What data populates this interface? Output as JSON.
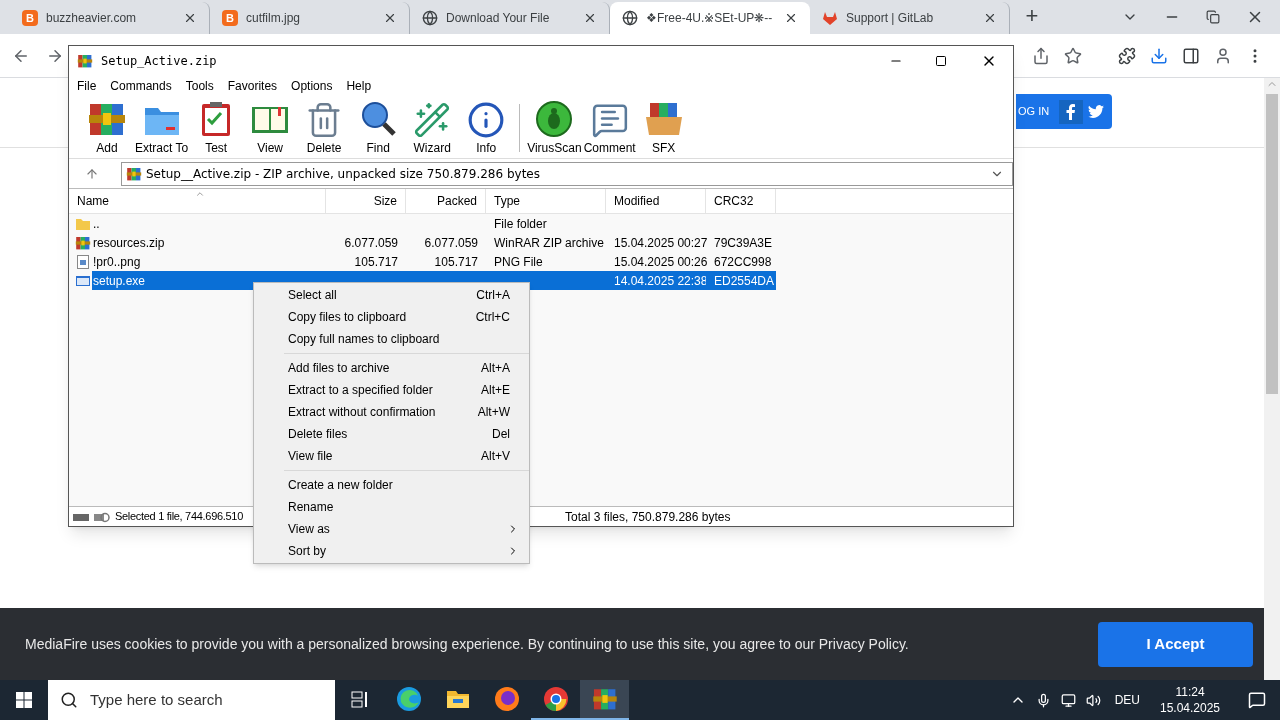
{
  "browser": {
    "tabs": [
      {
        "title": "buzzheavier.com",
        "kind": "letter",
        "favicon_text": "B",
        "selected": false
      },
      {
        "title": "cutfilm.jpg",
        "kind": "letter",
        "favicon_text": "B",
        "selected": false
      },
      {
        "title": "Download Your File",
        "kind": "globe",
        "selected": false
      },
      {
        "title": "❖Free-4U.※SEt-UP❋--",
        "kind": "globe",
        "selected": true
      },
      {
        "title": "Support | GitLab",
        "kind": "fox",
        "selected": false
      }
    ],
    "new_tab": "+"
  },
  "page": {
    "login_button": "OG IN",
    "cookie_banner": {
      "text": "MediaFire uses cookies to provide you with a personalized browsing experience. By continuing to use this site, you agree to our Privacy Policy.",
      "button": "I Accept"
    }
  },
  "winrar": {
    "title": "Setup_Active.zip",
    "menu": [
      "File",
      "Commands",
      "Tools",
      "Favorites",
      "Options",
      "Help"
    ],
    "toolbar_groups": [
      [
        {
          "label": "Add",
          "kind": "add"
        },
        {
          "label": "Extract To",
          "kind": "extract"
        },
        {
          "label": "Test",
          "kind": "test"
        },
        {
          "label": "View",
          "kind": "view"
        },
        {
          "label": "Delete",
          "kind": "delete"
        },
        {
          "label": "Find",
          "kind": "find"
        },
        {
          "label": "Wizard",
          "kind": "wizard"
        },
        {
          "label": "Info",
          "kind": "info"
        }
      ],
      [
        {
          "label": "VirusScan",
          "kind": "virus"
        },
        {
          "label": "Comment",
          "kind": "comment"
        },
        {
          "label": "SFX",
          "kind": "sfx"
        }
      ]
    ],
    "path": "Setup__Active.zip - ZIP archive, unpacked size 750.879.286 bytes",
    "columns": [
      "Name",
      "Size",
      "Packed",
      "Type",
      "Modified",
      "CRC32"
    ],
    "rows": [
      {
        "kind": "folder",
        "name": "..",
        "type": "File folder",
        "selected": false
      },
      {
        "kind": "zip",
        "name": "resources.zip",
        "size": "6.077.059",
        "packed": "6.077.059",
        "type": "WinRAR ZIP archive",
        "modified": "15.04.2025 00:27",
        "crc32": "79C39A3E",
        "selected": false
      },
      {
        "kind": "png",
        "name": "!pr0..png",
        "size": "105.717",
        "packed": "105.717",
        "type": "PNG File",
        "modified": "15.04.2025 00:26",
        "crc32": "672CC998",
        "selected": false
      },
      {
        "kind": "exe",
        "name": "setup.exe",
        "modified": "14.04.2025 22:38",
        "crc32": "ED2554DA",
        "selected": true
      }
    ],
    "status_left": "Selected 1 file, 744.696.510",
    "status_right": "Total 3 files, 750.879.286 bytes"
  },
  "context_menu": {
    "groups": [
      [
        {
          "label": "Select all",
          "shortcut": "Ctrl+A",
          "submenu": false
        },
        {
          "label": "Copy files to clipboard",
          "shortcut": "Ctrl+C",
          "submenu": false
        },
        {
          "label": "Copy full names to clipboard",
          "submenu": false
        }
      ],
      [
        {
          "label": "Add files to archive",
          "shortcut": "Alt+A",
          "submenu": false
        },
        {
          "label": "Extract to a specified folder",
          "shortcut": "Alt+E",
          "submenu": false
        },
        {
          "label": "Extract without confirmation",
          "shortcut": "Alt+W",
          "submenu": false
        },
        {
          "label": "Delete files",
          "shortcut": "Del",
          "submenu": false
        },
        {
          "label": "View file",
          "shortcut": "Alt+V",
          "submenu": false
        }
      ],
      [
        {
          "label": "Create a new folder",
          "submenu": false
        },
        {
          "label": "Rename",
          "submenu": false
        },
        {
          "label": "View as",
          "submenu": true
        },
        {
          "label": "Sort by",
          "submenu": true
        }
      ]
    ]
  },
  "taskbar": {
    "search_placeholder": "Type here to search",
    "apps": [
      {
        "kind": "taskview",
        "running": false,
        "selected": false
      },
      {
        "kind": "edge",
        "running": false,
        "selected": false
      },
      {
        "kind": "explorer",
        "running": false,
        "selected": false
      },
      {
        "kind": "firefox",
        "running": false,
        "selected": false
      },
      {
        "kind": "chrome",
        "running": true,
        "selected": false
      },
      {
        "kind": "winrar",
        "running": true,
        "selected": true
      }
    ],
    "language": "DEU",
    "time": "11:24",
    "date": "15.04.2025"
  }
}
